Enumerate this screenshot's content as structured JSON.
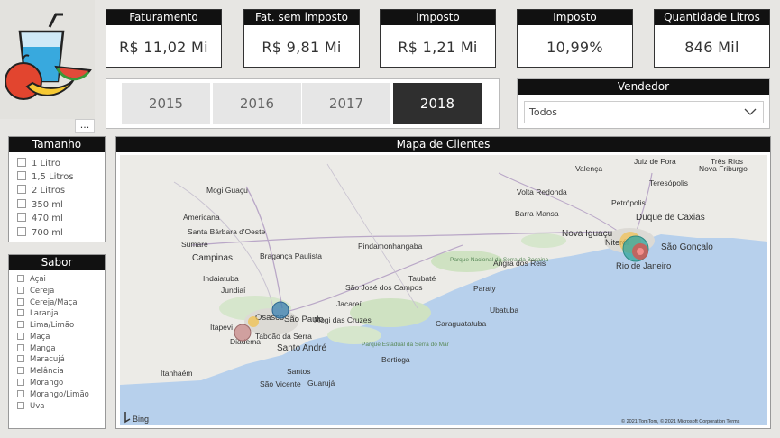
{
  "kpis": [
    {
      "title": "Faturamento",
      "value": "R$ 11,02 Mi"
    },
    {
      "title": "Fat. sem imposto",
      "value": "R$ 9,81 Mi"
    },
    {
      "title": "Imposto",
      "value": "R$ 1,21 Mi"
    },
    {
      "title": "Imposto",
      "value": "10,99%"
    },
    {
      "title": "Quantidade Litros",
      "value": "846 Mil"
    }
  ],
  "years": {
    "options": [
      "2015",
      "2016",
      "2017",
      "2018"
    ],
    "selected": "2018"
  },
  "vendedor": {
    "title": "Vendedor",
    "value": "Todos"
  },
  "tamanho": {
    "title": "Tamanho",
    "items": [
      "1 Litro",
      "1,5 Litros",
      "2 Litros",
      "350 ml",
      "470 ml",
      "700 ml"
    ]
  },
  "sabor": {
    "title": "Sabor",
    "items": [
      "Açai",
      "Cereja",
      "Cereja/Maça",
      "Laranja",
      "Lima/Limão",
      "Maça",
      "Manga",
      "Maracujá",
      "Melância",
      "Morango",
      "Morango/Limão",
      "Uva"
    ]
  },
  "more_label": "...",
  "map": {
    "title": "Mapa de Clientes",
    "labels": [
      "Valença",
      "Juiz de Fora",
      "Três Rios",
      "Mogi Guaçu",
      "Volta Redonda",
      "Teresópolis",
      "Nova Friburgo",
      "Barra Mansa",
      "Petrópolis",
      "Americana",
      "Santa Bárbara d'Oeste",
      "Sumaré",
      "Campinas",
      "Bragança Paulista",
      "Pindamonhangaba",
      "Duque de Caxias",
      "Nova Iguaçu",
      "São Gonçalo",
      "Niterói",
      "Rio de Janeiro",
      "Angra dos Reis",
      "Parque Nacional da Serra da Bocaina",
      "Paraty",
      "Indaiatuba",
      "Jundiaí",
      "Taubaté",
      "Jacareí",
      "São José dos Campos",
      "Osasco",
      "São Paulo",
      "Mogi das Cruzes",
      "Itapevi",
      "Diadema",
      "Taboão da Serra",
      "Santo André",
      "Parque Estadual da Serra do Mar",
      "Santos",
      "Guarujá",
      "São Vicente",
      "Itanhaém",
      "Bertioga",
      "Ubatuba",
      "Caraguatatuba"
    ],
    "bing": "Bing",
    "copyright": "© 2021 TomTom, © 2021 Microsoft Corporation Terms"
  },
  "colors": {
    "header": "#111111",
    "selected_year": "#2f2f2f",
    "sea": "#b7d0ec",
    "land": "#ecebe7",
    "bubble_blue": "#3a7fb0",
    "bubble_teal": "#3aa8a0",
    "bubble_yellow": "#f2c14e",
    "bubble_red": "#d9534f",
    "bubble_pink": "#c98d8d"
  }
}
